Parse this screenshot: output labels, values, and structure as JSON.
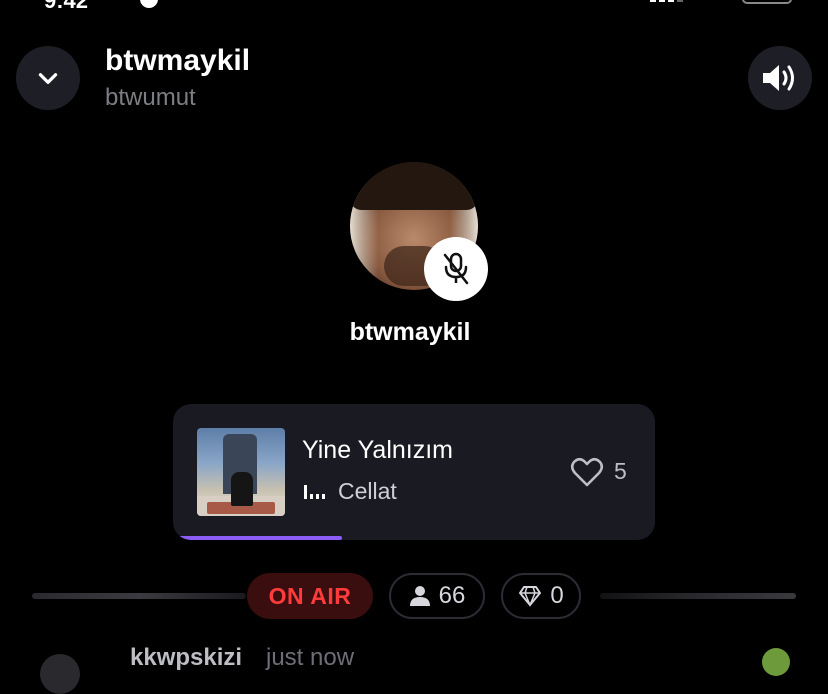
{
  "status_bar": {
    "time": "9:42"
  },
  "header": {
    "host_name": "btwmaykil",
    "host_handle": "btwumut",
    "collapse_icon": "chevron-down-icon",
    "volume_icon": "speaker-volume-icon"
  },
  "stage": {
    "speaker_name": "btwmaykil",
    "mute_icon": "mic-off-icon"
  },
  "now_playing": {
    "title": "Yine Yalnızım",
    "artist": "Cellat",
    "likes": "5",
    "progress": 0.35,
    "accent_color": "#8b5cf6"
  },
  "stats": {
    "on_air_label": "ON AIR",
    "listeners": "66",
    "gems": "0",
    "on_air_color": "#ff3b3b"
  },
  "comments": [
    {
      "user": "kkwpskizi",
      "time": "just now"
    }
  ]
}
